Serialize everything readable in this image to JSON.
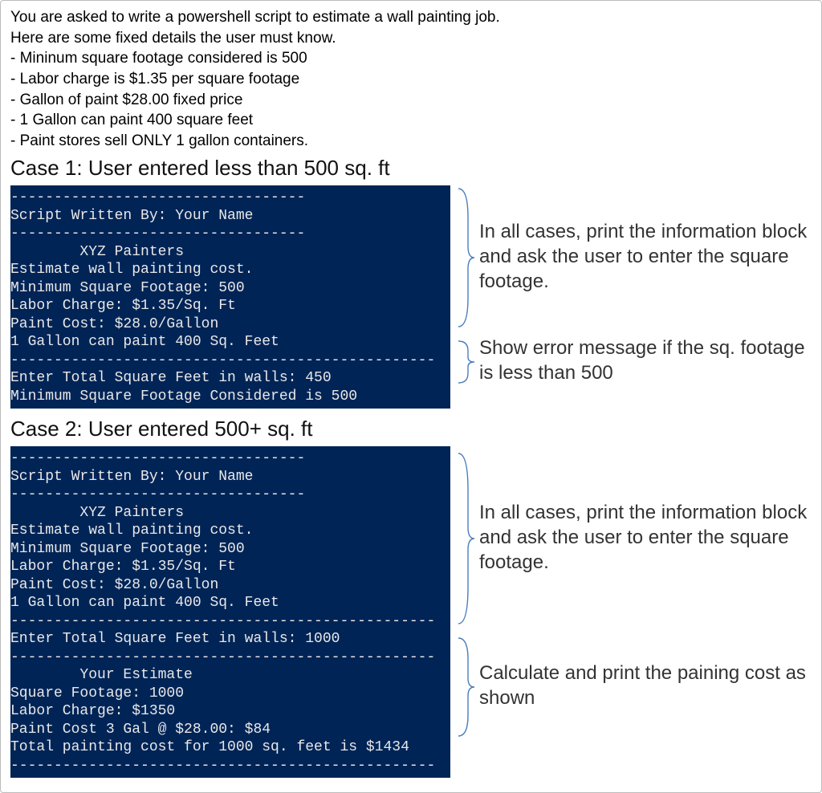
{
  "intro": {
    "line1": "You are asked to write a powershell script to estimate a wall painting job.",
    "line2": "Here are some fixed details the user must know.",
    "b1": "- Mininum square footage considered is 500",
    "b2": "- Labor charge is $1.35 per square footage",
    "b3": "- Gallon of paint $28.00 fixed price",
    "b4": "- 1 Gallon can paint 400 square feet",
    "b5": "- Paint stores sell ONLY 1 gallon containers."
  },
  "case1": {
    "heading": "Case 1: User entered less than 500 sq. ft",
    "terminal": "----------------------------------\nScript Written By: Your Name\n----------------------------------\n        XYZ Painters\nEstimate wall painting cost.\nMinimum Square Footage: 500\nLabor Charge: $1.35/Sq. Ft\nPaint Cost: $28.0/Gallon\n1 Gallon can paint 400 Sq. Feet\n-------------------------------------------------\nEnter Total Square Feet in walls: 450\nMinimum Square Footage Considered is 500",
    "ann_top": "In all cases, print the information block and ask the user to enter the square footage.",
    "ann_bottom": "Show error message if the sq. footage is less than 500"
  },
  "case2": {
    "heading": "Case 2: User entered 500+ sq. ft",
    "terminal": "----------------------------------\nScript Written By: Your Name\n----------------------------------\n        XYZ Painters\nEstimate wall painting cost.\nMinimum Square Footage: 500\nLabor Charge: $1.35/Sq. Ft\nPaint Cost: $28.0/Gallon\n1 Gallon can paint 400 Sq. Feet\n-------------------------------------------------\nEnter Total Square Feet in walls: 1000\n-------------------------------------------------\n        Your Estimate\nSquare Footage: 1000\nLabor Charge: $1350\nPaint Cost 3 Gal @ $28.00: $84\nTotal painting cost for 1000 sq. feet is $1434\n-------------------------------------------------",
    "ann_top": "In all cases, print the information block and ask the user to enter the square footage.",
    "ann_bottom": "Calculate and print the paining cost as shown"
  }
}
